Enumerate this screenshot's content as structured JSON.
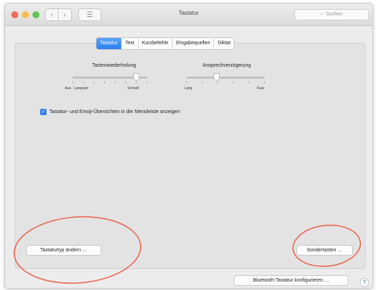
{
  "window": {
    "title": "Tastatur",
    "search_placeholder": "Suchen",
    "traffic_light_colors": {
      "close": "#ee6b5f",
      "minimize": "#f6be4f",
      "zoom": "#62c554"
    },
    "nav_back_icon": "‹",
    "nav_forward_icon": "›",
    "grid_icon": "☰"
  },
  "tabs": [
    {
      "label": "Tastatur",
      "active": true
    },
    {
      "label": "Text",
      "active": false
    },
    {
      "label": "Kurzbefehle",
      "active": false
    },
    {
      "label": "Eingabequellen",
      "active": false
    },
    {
      "label": "Diktat",
      "active": false
    }
  ],
  "sliders": {
    "repeat": {
      "title": "Tastenwiederholung",
      "left_label": "Aus",
      "mid_label": "Langsam",
      "right_label": "Schnell",
      "value_fraction": 0.85
    },
    "delay": {
      "title": "Ansprechverzögerung",
      "left_label": "Lang",
      "right_label": "Kurz",
      "value_fraction": 0.38
    }
  },
  "checkbox": {
    "label": "Tastatur- und Emoji-Übersichten in der Menüleiste anzeigen",
    "checked": true,
    "mark": "✓"
  },
  "buttons": {
    "change_keyboard_type": "Tastaturtyp ändern …",
    "modifier_keys": "Sondertasten …",
    "bluetooth_setup": "Bluetooth-Tastatur konfigurieren …",
    "help": "?"
  },
  "colors": {
    "accent": "#2f7ff2",
    "annotation": "#e8664f"
  }
}
